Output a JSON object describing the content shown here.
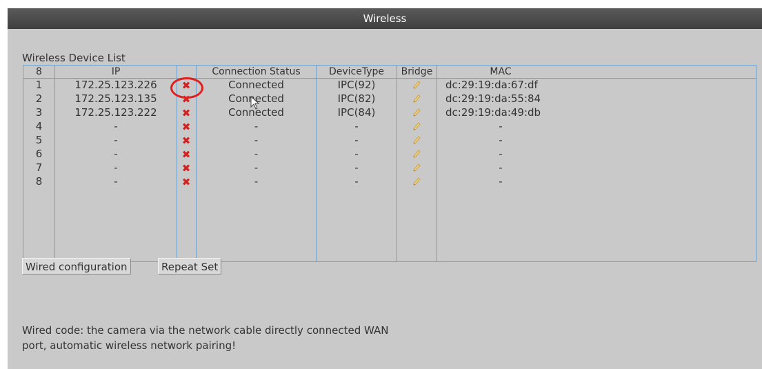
{
  "window": {
    "title": "Wireless"
  },
  "device_list": {
    "label": "Wireless Device List",
    "columns": {
      "index": "8",
      "ip": "IP",
      "delete": "",
      "status": "Connection Status",
      "device_type": "DeviceType",
      "bridge": "Bridge",
      "mac": "MAC"
    },
    "rows": [
      {
        "index": "1",
        "ip": "172.25.123.226",
        "status": "Connected",
        "device_type": "IPC(92)",
        "mac": "dc:29:19:da:67:df"
      },
      {
        "index": "2",
        "ip": "172.25.123.135",
        "status": "Connected",
        "device_type": "IPC(82)",
        "mac": "dc:29:19:da:55:84"
      },
      {
        "index": "3",
        "ip": "172.25.123.222",
        "status": "Connected",
        "device_type": "IPC(84)",
        "mac": "dc:29:19:da:49:db"
      },
      {
        "index": "4",
        "ip": "-",
        "status": "-",
        "device_type": "-",
        "mac": "-"
      },
      {
        "index": "5",
        "ip": "-",
        "status": "-",
        "device_type": "-",
        "mac": "-"
      },
      {
        "index": "6",
        "ip": "-",
        "status": "-",
        "device_type": "-",
        "mac": "-"
      },
      {
        "index": "7",
        "ip": "-",
        "status": "-",
        "device_type": "-",
        "mac": "-"
      },
      {
        "index": "8",
        "ip": "-",
        "status": "-",
        "device_type": "-",
        "mac": "-"
      }
    ],
    "icons": {
      "delete": "delete-x-icon",
      "bridge": "pencil-edit-icon"
    }
  },
  "buttons": {
    "wired_config": "Wired configuration",
    "repeat_set": "Repeat Set"
  },
  "note": {
    "line1": "Wired code: the camera via the network cable directly connected WAN",
    "line2": "port, automatic wireless network pairing!"
  },
  "colors": {
    "title_bar": "#3f3f3f",
    "dialog_bg": "#c9c9c9",
    "grid_line": "#6f9fc8",
    "delete_icon": "#d42020",
    "highlight_ring": "#e02020"
  }
}
